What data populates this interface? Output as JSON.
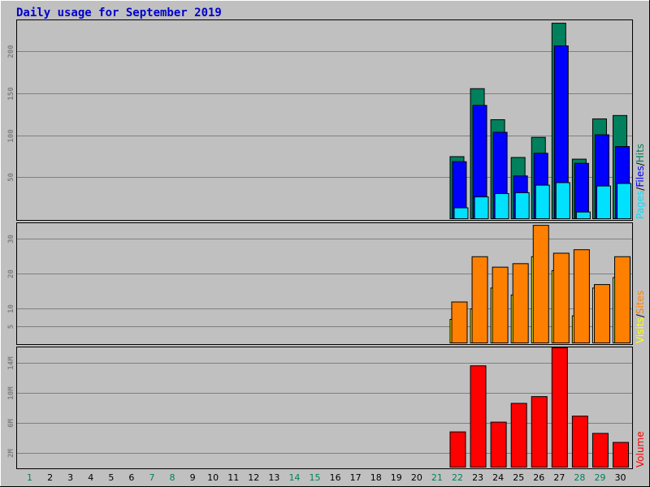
{
  "title": "Daily usage for September 2019",
  "colors": {
    "title": "#0000cc",
    "hits": "#00805c",
    "files": "#0000ff",
    "pages": "#00e0ff",
    "visits": "#ffff00",
    "sites": "#ff8000",
    "volume": "#ff0000",
    "weekend": "#00805c",
    "weekday": "#000000",
    "grid": "#808080",
    "panel": "#c0c0c0"
  },
  "legends": {
    "top": [
      {
        "text": "Pages",
        "color": "#00e0ff"
      },
      {
        "text": "/",
        "color": "#000000"
      },
      {
        "text": "Files",
        "color": "#0000ff"
      },
      {
        "text": "/",
        "color": "#000000"
      },
      {
        "text": "Hits",
        "color": "#00805c"
      }
    ],
    "middle": [
      {
        "text": "Visits",
        "color": "#ffff00"
      },
      {
        "text": "/",
        "color": "#000000"
      },
      {
        "text": "Sites",
        "color": "#ff8000"
      }
    ],
    "bottom": [
      {
        "text": "Volume",
        "color": "#ff0000"
      }
    ]
  },
  "chart_data": [
    {
      "type": "bar",
      "panel": "hits-files-pages",
      "categories": [
        "1",
        "2",
        "3",
        "4",
        "5",
        "6",
        "7",
        "8",
        "9",
        "10",
        "11",
        "12",
        "13",
        "14",
        "15",
        "16",
        "17",
        "18",
        "19",
        "20",
        "21",
        "22",
        "23",
        "24",
        "25",
        "26",
        "27",
        "28",
        "29",
        "30"
      ],
      "weekend_days": [
        "1",
        "7",
        "8",
        "14",
        "15",
        "21",
        "22",
        "28",
        "29"
      ],
      "ylim": [
        0,
        237
      ],
      "yticks": [
        50,
        100,
        150,
        200
      ],
      "series": [
        {
          "name": "Hits",
          "values": [
            0,
            0,
            0,
            0,
            0,
            0,
            0,
            0,
            0,
            0,
            0,
            0,
            0,
            0,
            0,
            0,
            0,
            0,
            0,
            0,
            0,
            75,
            156,
            119,
            74,
            98,
            234,
            72,
            120,
            124
          ]
        },
        {
          "name": "Files",
          "values": [
            0,
            0,
            0,
            0,
            0,
            0,
            0,
            0,
            0,
            0,
            0,
            0,
            0,
            0,
            0,
            0,
            0,
            0,
            0,
            0,
            0,
            69,
            136,
            104,
            52,
            79,
            207,
            67,
            101,
            87
          ]
        },
        {
          "name": "Pages",
          "values": [
            0,
            0,
            0,
            0,
            0,
            0,
            0,
            0,
            0,
            0,
            0,
            0,
            0,
            0,
            0,
            0,
            0,
            0,
            0,
            0,
            0,
            14,
            27,
            31,
            32,
            41,
            44,
            9,
            40,
            43
          ]
        }
      ]
    },
    {
      "type": "bar",
      "panel": "visits-sites",
      "categories": [
        "1",
        "2",
        "3",
        "4",
        "5",
        "6",
        "7",
        "8",
        "9",
        "10",
        "11",
        "12",
        "13",
        "14",
        "15",
        "16",
        "17",
        "18",
        "19",
        "20",
        "21",
        "22",
        "23",
        "24",
        "25",
        "26",
        "27",
        "28",
        "29",
        "30"
      ],
      "ylim": [
        0,
        34.5
      ],
      "yticks": [
        5,
        10,
        20,
        30
      ],
      "series": [
        {
          "name": "Visits",
          "values": [
            0,
            0,
            0,
            0,
            0,
            0,
            0,
            0,
            0,
            0,
            0,
            0,
            0,
            0,
            0,
            0,
            0,
            0,
            0,
            0,
            0,
            7,
            10,
            16,
            14,
            25,
            21,
            8,
            16,
            19
          ]
        },
        {
          "name": "Sites",
          "values": [
            0,
            0,
            0,
            0,
            0,
            0,
            0,
            0,
            0,
            0,
            0,
            0,
            0,
            0,
            0,
            0,
            0,
            0,
            0,
            0,
            0,
            12,
            25,
            22,
            23,
            34,
            26,
            27,
            17,
            25
          ]
        }
      ]
    },
    {
      "type": "bar",
      "panel": "volume",
      "categories": [
        "1",
        "2",
        "3",
        "4",
        "5",
        "6",
        "7",
        "8",
        "9",
        "10",
        "11",
        "12",
        "13",
        "14",
        "15",
        "16",
        "17",
        "18",
        "19",
        "20",
        "21",
        "22",
        "23",
        "24",
        "25",
        "26",
        "27",
        "28",
        "29",
        "30"
      ],
      "ylim": [
        0,
        16
      ],
      "yticks": [
        2,
        6,
        10,
        14
      ],
      "ytick_labels": [
        "2M",
        "6M",
        "10M",
        "14M"
      ],
      "series": [
        {
          "name": "Volume",
          "values": [
            0,
            0,
            0,
            0,
            0,
            0,
            0,
            0,
            0,
            0,
            0,
            0,
            0,
            0,
            0,
            0,
            0,
            0,
            0,
            0,
            0,
            4.8,
            13.6,
            6.1,
            8.6,
            9.5,
            16.0,
            6.9,
            4.6,
            3.4
          ]
        }
      ]
    }
  ]
}
